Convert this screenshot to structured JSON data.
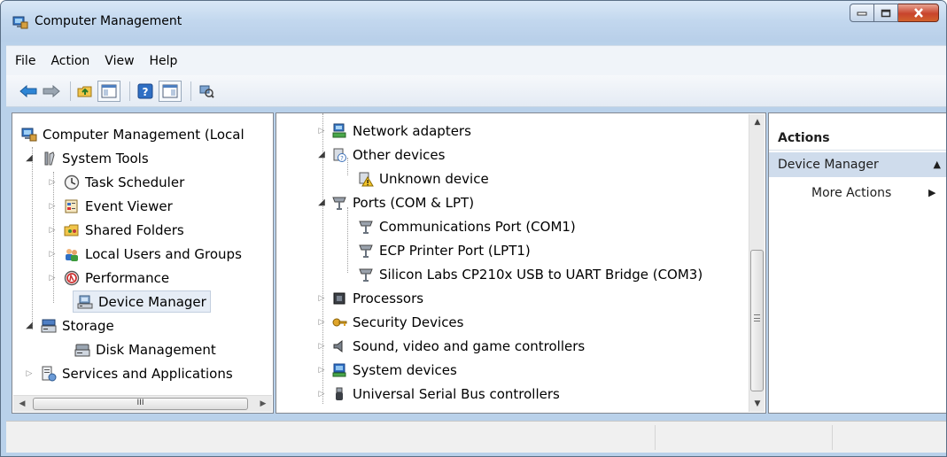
{
  "window": {
    "title": "Computer Management"
  },
  "menu": [
    "File",
    "Action",
    "View",
    "Help"
  ],
  "left_tree": [
    {
      "label": "Computer Management (Local",
      "icon": "computer-management-icon",
      "level": 0,
      "expander": "none"
    },
    {
      "label": "System Tools",
      "icon": "system-tools-icon",
      "level": 1,
      "expander": "open"
    },
    {
      "label": "Task Scheduler",
      "icon": "clock-icon",
      "level": 2,
      "expander": "closed"
    },
    {
      "label": "Event Viewer",
      "icon": "event-viewer-icon",
      "level": 2,
      "expander": "closed"
    },
    {
      "label": "Shared Folders",
      "icon": "shared-folders-icon",
      "level": 2,
      "expander": "closed"
    },
    {
      "label": "Local Users and Groups",
      "icon": "users-icon",
      "level": 2,
      "expander": "closed"
    },
    {
      "label": "Performance",
      "icon": "performance-icon",
      "level": 2,
      "expander": "closed"
    },
    {
      "label": "Device Manager",
      "icon": "device-manager-icon",
      "level": 2,
      "expander": "none",
      "selected": true
    },
    {
      "label": "Storage",
      "icon": "storage-icon",
      "level": 1,
      "expander": "open"
    },
    {
      "label": "Disk Management",
      "icon": "disk-icon",
      "level": 2,
      "expander": "none"
    },
    {
      "label": "Services and Applications",
      "icon": "services-icon",
      "level": 1,
      "expander": "closed"
    }
  ],
  "left_scroll": {
    "grip": "III"
  },
  "device_tree": [
    {
      "label": "Network adapters",
      "icon": "network-adapter-icon",
      "level": 0,
      "expander": "closed"
    },
    {
      "label": "Other devices",
      "icon": "other-devices-icon",
      "level": 0,
      "expander": "open"
    },
    {
      "label": "Unknown device",
      "icon": "unknown-device-warning-icon",
      "level": 1,
      "expander": "none"
    },
    {
      "label": "Ports (COM & LPT)",
      "icon": "port-icon",
      "level": 0,
      "expander": "open"
    },
    {
      "label": "Communications Port (COM1)",
      "icon": "port-icon",
      "level": 1,
      "expander": "none"
    },
    {
      "label": "ECP Printer Port (LPT1)",
      "icon": "port-icon",
      "level": 1,
      "expander": "none"
    },
    {
      "label": "Silicon Labs CP210x USB to UART Bridge (COM3)",
      "icon": "port-icon",
      "level": 1,
      "expander": "none"
    },
    {
      "label": "Processors",
      "icon": "processor-icon",
      "level": 0,
      "expander": "closed"
    },
    {
      "label": "Security Devices",
      "icon": "security-device-icon",
      "level": 0,
      "expander": "closed"
    },
    {
      "label": "Sound, video and game controllers",
      "icon": "speaker-icon",
      "level": 0,
      "expander": "closed"
    },
    {
      "label": "System devices",
      "icon": "system-devices-icon",
      "level": 0,
      "expander": "closed"
    },
    {
      "label": "Universal Serial Bus controllers",
      "icon": "usb-icon",
      "level": 0,
      "expander": "closed"
    }
  ],
  "actions": {
    "header": "Actions",
    "section": "Device Manager",
    "more": "More Actions"
  },
  "colors": {
    "window_frame": "#b9d1ea",
    "selection": "#e6edf6",
    "actions_section": "#cfdcec",
    "close_button": "#c8442c"
  }
}
